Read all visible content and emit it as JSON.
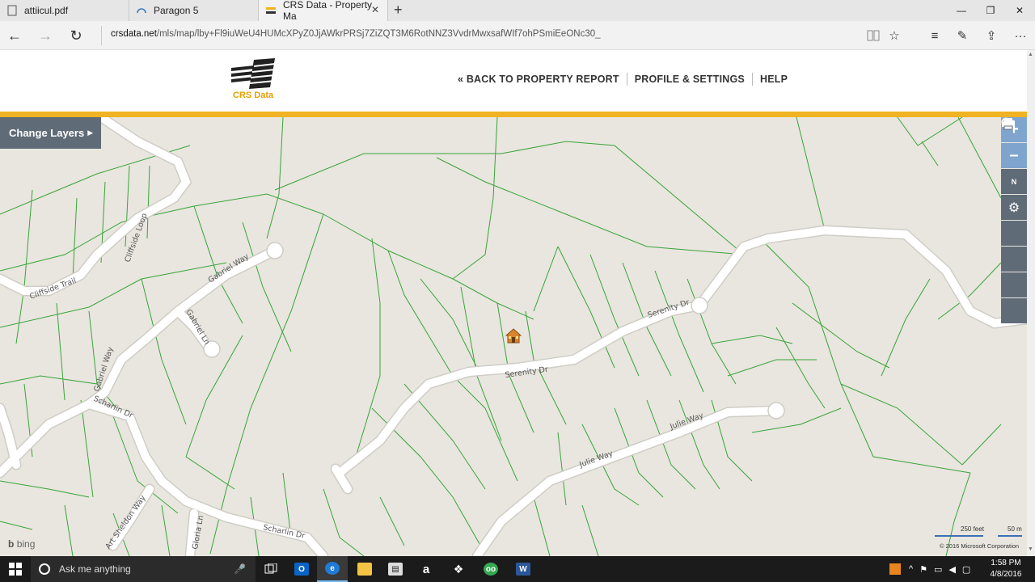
{
  "browser": {
    "tabs": [
      {
        "title": "attiicul.pdf",
        "icon": "document-icon",
        "active": false
      },
      {
        "title": "Paragon 5",
        "icon": "gauge-icon",
        "active": false
      },
      {
        "title": "CRS Data - Property Ma",
        "icon": "crs-favicon",
        "active": true
      }
    ],
    "new_tab_label": "+",
    "url_domain": "crsdata.net",
    "url_path": "/mls/map/lby+Fl9iuWeU4HUMcXPyZ0JjAWkrPRSj7ZiZQT3M6RotNNZ3VvdrMwxsafWIf7ohPSmiEeONc30_",
    "more_label": "···"
  },
  "site": {
    "logo_text": "CRS Data",
    "nav": [
      {
        "label": "« BACK TO PROPERTY REPORT"
      },
      {
        "label": "PROFILE & SETTINGS"
      },
      {
        "label": "HELP"
      }
    ],
    "accent_color": "#f0b323"
  },
  "map": {
    "change_layers_label": "Change Layers",
    "tools": [
      "zoom-in-icon",
      "zoom-out-icon",
      "compass-icon",
      "settings-icon",
      "location-pin-icon",
      "magnify-icon",
      "measure-icon",
      "print-icon"
    ],
    "zoom_in": "+",
    "zoom_out": "–",
    "compass_label": "N",
    "road_labels": [
      "Cliffside Trail",
      "Cliffside Loop",
      "Gabriel Way",
      "Gabriel Ln",
      "Gabriel Way",
      "Scharlin Dr",
      "Scharlin Dr",
      "Serenity Dr",
      "Serenity Dr",
      "Julie Way",
      "Julie Way",
      "Gloria Ln",
      "Art Sheldon Way"
    ],
    "provider": "bing",
    "scale_feet": "250 feet",
    "scale_meters": "50 m",
    "copyright": "© 2016 Microsoft Corporation",
    "parcel_color": "#3aa33a",
    "road_color": "#ffffff"
  },
  "taskbar": {
    "search_placeholder": "Ask me anything",
    "apps": [
      "task-view-icon",
      "outlook-icon",
      "edge-icon",
      "file-explorer-icon",
      "store-icon",
      "amazon-icon",
      "dropbox-icon",
      "tripadvisor-icon",
      "word-icon"
    ],
    "time": "1:58 PM",
    "date": "4/8/2016"
  }
}
